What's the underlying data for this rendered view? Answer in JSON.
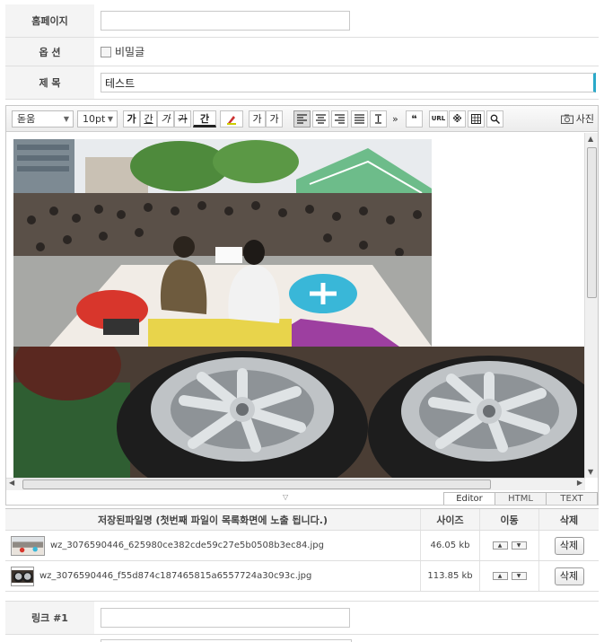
{
  "form": {
    "homepage_label": "홈페이지",
    "homepage_value": "",
    "option_label": "옵 션",
    "secret_label": "비밀글",
    "title_label": "제 목",
    "title_value": "테스트",
    "link1_label": "링크 #1",
    "link1_value": ""
  },
  "editor": {
    "font_family": "돋움",
    "font_size": "10pt",
    "bold_label": "가",
    "underline_label": "간",
    "italic_label": "가",
    "strike_label": "가",
    "color_label": "간",
    "super_label": "가",
    "sub_label": "가",
    "more_label": "»",
    "url_label": "URL",
    "photo_label": "사진",
    "modes": [
      "Editor",
      "HTML",
      "TEXT"
    ]
  },
  "files": {
    "headers": [
      "저장된파일명 (첫번째 파일이 목록화면에 노출 됩니다.)",
      "사이즈",
      "이동",
      "삭제"
    ],
    "rows": [
      {
        "name": "wz_3076590446_625980ce382cde59c27e5b0508b3ec84.jpg",
        "size": "46.05 kb",
        "delete": "삭제"
      },
      {
        "name": "wz_3076590446_f55d874c187465815a6557724a30c93c.jpg",
        "size": "113.85 kb",
        "delete": "삭제"
      }
    ]
  },
  "colors": {
    "accent_cyan": "#2aa9c9",
    "header_gray": "#f4f4f4"
  }
}
